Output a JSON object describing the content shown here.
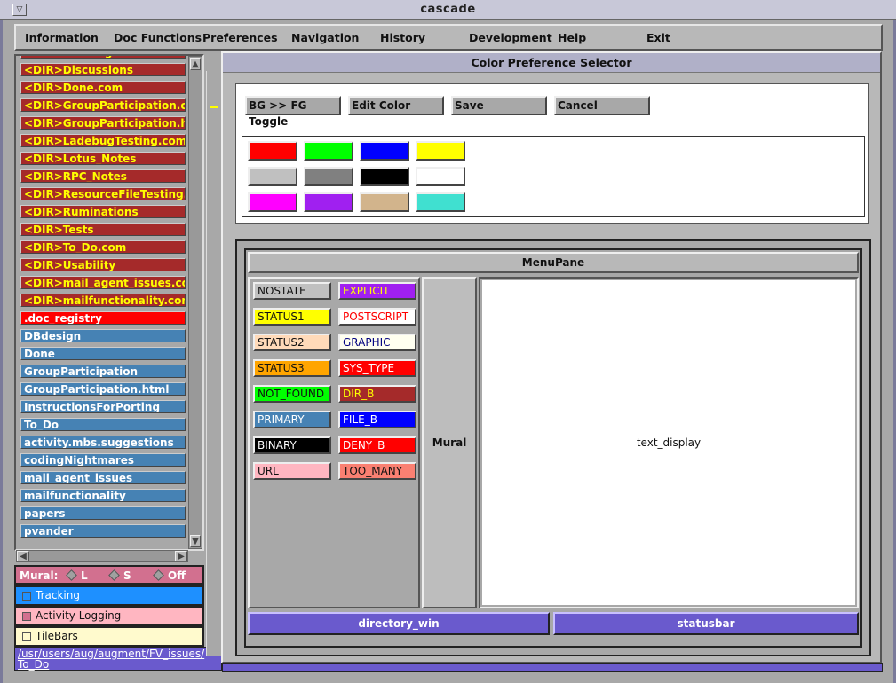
{
  "window": {
    "title": "cascade"
  },
  "menubar": [
    "Information",
    "Doc Functions",
    "Preferences",
    "Navigation",
    "History",
    "Development",
    "Help",
    "Exit"
  ],
  "directory_list": [
    {
      "label": "<DIR>DBdesign.com",
      "kind": "dir"
    },
    {
      "label": "<DIR>Discussions",
      "kind": "dir"
    },
    {
      "label": "<DIR>Done.com",
      "kind": "dir"
    },
    {
      "label": "<DIR>GroupParticipation.com",
      "kind": "dir"
    },
    {
      "label": "<DIR>GroupParticipation.html.com",
      "kind": "dir"
    },
    {
      "label": "<DIR>LadebugTesting.com",
      "kind": "dir"
    },
    {
      "label": "<DIR>Lotus_Notes",
      "kind": "dir"
    },
    {
      "label": "<DIR>RPC_Notes",
      "kind": "dir"
    },
    {
      "label": "<DIR>ResourceFileTesting.com",
      "kind": "dir"
    },
    {
      "label": "<DIR>Ruminations",
      "kind": "dir"
    },
    {
      "label": "<DIR>Tests",
      "kind": "dir"
    },
    {
      "label": "<DIR>To_Do.com",
      "kind": "dir"
    },
    {
      "label": "<DIR>Usability",
      "kind": "dir"
    },
    {
      "label": "<DIR>mail_agent_issues.com",
      "kind": "dir"
    },
    {
      "label": "<DIR>mailfunctionality.com",
      "kind": "dir"
    },
    {
      "label": ".doc_registry",
      "kind": "reg"
    },
    {
      "label": "DBdesign",
      "kind": "file"
    },
    {
      "label": "Done",
      "kind": "file"
    },
    {
      "label": "GroupParticipation",
      "kind": "file"
    },
    {
      "label": "GroupParticipation.html",
      "kind": "file"
    },
    {
      "label": "InstructionsForPorting",
      "kind": "file"
    },
    {
      "label": "To_Do",
      "kind": "file"
    },
    {
      "label": "activity.mbs.suggestions",
      "kind": "file"
    },
    {
      "label": "codingNightmares",
      "kind": "file"
    },
    {
      "label": "mail_agent_issues",
      "kind": "file"
    },
    {
      "label": "mailfunctionality",
      "kind": "file"
    },
    {
      "label": "papers",
      "kind": "file"
    },
    {
      "label": "pvander",
      "kind": "file"
    }
  ],
  "mural": {
    "label": "Mural:",
    "options": [
      "L",
      "S",
      "Off"
    ]
  },
  "toggles": [
    {
      "label": "Tracking",
      "bg": "#1e90ff",
      "color": "#ffffff",
      "box": "#1e90ff"
    },
    {
      "label": "Activity Logging",
      "bg": "#ffb6c1",
      "color": "#111111",
      "box": "#d2708f"
    },
    {
      "label": "TileBars",
      "bg": "#fffacd",
      "color": "#111111",
      "box": "#fffacd"
    }
  ],
  "path": {
    "line1": "/usr/users/aug/augment/FV_issues/",
    "line2": "To_Do"
  },
  "dialog": {
    "title": "Color Preference Selector",
    "buttons": [
      "BG >> FG Toggle",
      "Edit Color",
      "Save",
      "Cancel"
    ],
    "swatches": [
      [
        "#ff0000",
        "#00ff00",
        "#0000ff",
        "#ffff00"
      ],
      [
        "#c0c0c0",
        "#808080",
        "#000000",
        "#ffffff"
      ],
      [
        "#ff00ff",
        "#a020f0",
        "#d2b48c",
        "#40e0d0"
      ]
    ],
    "menupane_label": "MenuPane",
    "states": [
      {
        "label": "NOSTATE",
        "bg": "#c0c0c0",
        "color": "#111111"
      },
      {
        "label": "EXPLICIT",
        "bg": "#a020f0",
        "color": "#ffff00"
      },
      {
        "label": "STATUS1",
        "bg": "#ffff00",
        "color": "#111111"
      },
      {
        "label": "POSTSCRIPT",
        "bg": "#ffffff",
        "color": "#ff0000"
      },
      {
        "label": "STATUS2",
        "bg": "#ffdab9",
        "color": "#111111"
      },
      {
        "label": "GRAPHIC",
        "bg": "#fffff0",
        "color": "#000080"
      },
      {
        "label": "STATUS3",
        "bg": "#ffa500",
        "color": "#111111"
      },
      {
        "label": "SYS_TYPE",
        "bg": "#ff0000",
        "color": "#ffffff"
      },
      {
        "label": "NOT_FOUND",
        "bg": "#00ff00",
        "color": "#111111"
      },
      {
        "label": "DIR_B",
        "bg": "#a52a2a",
        "color": "#ffff00"
      },
      {
        "label": "PRIMARY",
        "bg": "#4682b4",
        "color": "#ffffff"
      },
      {
        "label": "FILE_B",
        "bg": "#0000ff",
        "color": "#ffffff"
      },
      {
        "label": "BINARY",
        "bg": "#000000",
        "color": "#ffffff"
      },
      {
        "label": "DENY_B",
        "bg": "#ff0000",
        "color": "#ffffff"
      },
      {
        "label": "URL",
        "bg": "#ffb6c1",
        "color": "#111111"
      },
      {
        "label": "TOO_MANY",
        "bg": "#fa8072",
        "color": "#111111"
      }
    ],
    "mural_label": "Mural",
    "text_display_label": "text_display",
    "directory_win_label": "directory_win",
    "statusbar_label": "statusbar"
  }
}
